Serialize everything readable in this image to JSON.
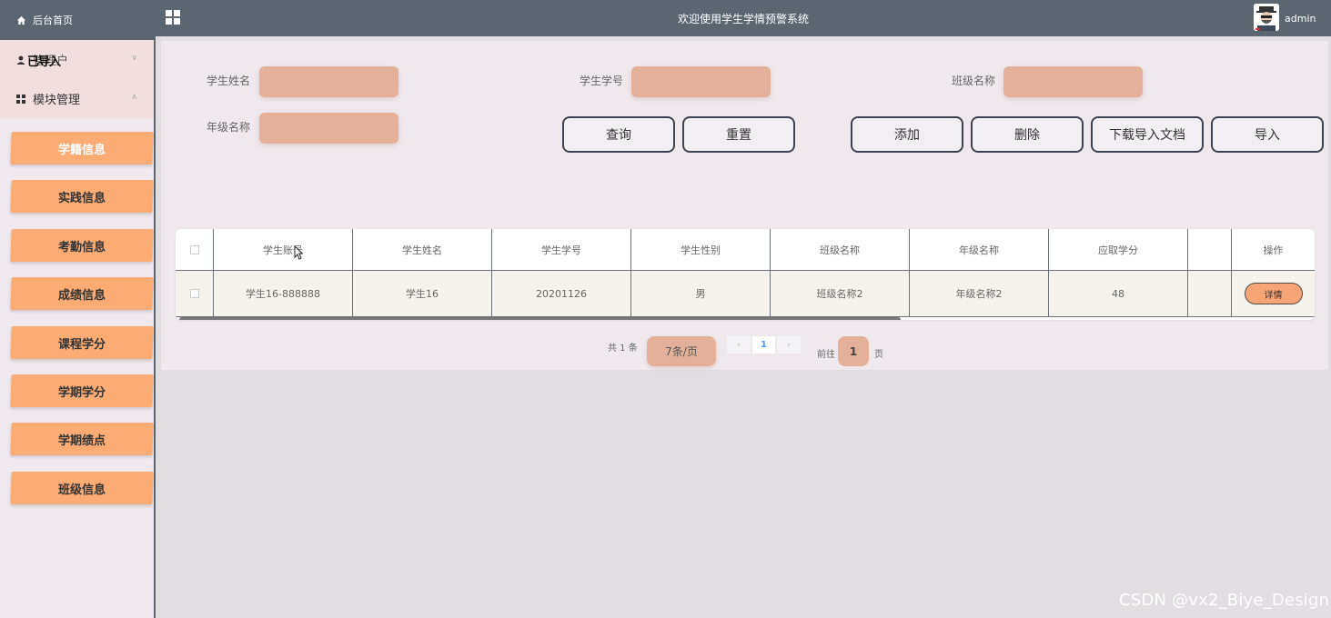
{
  "sidebar": {
    "home_label": "后台首页",
    "group1_label": "管理户",
    "group1_overlay": "已导入",
    "group2_label": "模块管理",
    "items": [
      {
        "label": "学籍信息"
      },
      {
        "label": "实践信息"
      },
      {
        "label": "考勤信息"
      },
      {
        "label": "成绩信息"
      },
      {
        "label": "课程学分"
      },
      {
        "label": "学期学分"
      },
      {
        "label": "学期绩点"
      },
      {
        "label": "班级信息"
      }
    ]
  },
  "header": {
    "title": "欢迎使用学生学情预警系统",
    "username": "admin"
  },
  "search": {
    "name_label": "学生姓名",
    "id_label": "学生学号",
    "class_label": "班级名称",
    "grade_label": "年级名称"
  },
  "buttons": {
    "query": "查询",
    "reset": "重置",
    "add": "添加",
    "delete": "删除",
    "download_template": "下载导入文档",
    "import": "导入"
  },
  "table": {
    "headers": [
      "学生账号",
      "学生姓名",
      "学生学号",
      "学生性别",
      "班级名称",
      "年级名称",
      "应取学分",
      "",
      "操作"
    ],
    "rows": [
      {
        "account": "学生16-888888",
        "name": "学生16",
        "number": "20201126",
        "gender": "男",
        "class": "班级名称2",
        "grade": "年级名称2",
        "credits": "48",
        "action": "详情"
      }
    ]
  },
  "pagination": {
    "total": "共 1 条",
    "page_size": "7条/页",
    "prev": "‹",
    "current": "1",
    "next": "›",
    "goto_label": "前往",
    "goto_value": "1",
    "page_suffix": "页"
  },
  "watermark": "CSDN @vx2_Biye_Design",
  "colors": {
    "header_bg": "#5c6670",
    "accent_orange": "#fbab74",
    "field_bg": "#e5b09a"
  }
}
